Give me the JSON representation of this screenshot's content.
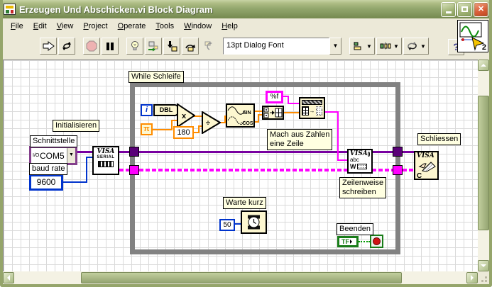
{
  "window": {
    "title": "Erzeugen Und Abschicken.vi Block Diagram"
  },
  "menu": {
    "items": [
      "File",
      "Edit",
      "View",
      "Project",
      "Operate",
      "Tools",
      "Window",
      "Help"
    ]
  },
  "toolbar": {
    "font_selector": "13pt Dialog Font",
    "help_label": "?",
    "vi_badge": "2"
  },
  "diagram": {
    "labels": {
      "initialize": "Initialisieren",
      "interface": "Schnittstelle",
      "baud_rate": "baud rate",
      "while_loop": "While Schleife",
      "make_line_1": "Mach aus Zahlen",
      "make_line_2": "eine Zeile",
      "wait_short": "Warte kurz",
      "write_lines_1": "Zeilenweise",
      "write_lines_2": "schreiben",
      "stop": "Beenden",
      "close": "Schliessen"
    },
    "values": {
      "com_port": "COM5",
      "io_glyph": "I/O",
      "baud": "9600",
      "iteration": "i",
      "dbl": "DBL",
      "pi": "π",
      "c180": "180",
      "multiply": "x",
      "divide": "÷",
      "sin": "SIN",
      "cos": ":COS",
      "format": "%f",
      "wait_ms": "50",
      "tf": "TF",
      "visa": "VISA",
      "serial": "SERIAL",
      "abc": "abc",
      "w": "W",
      "c": "C"
    },
    "colors": {
      "visa_wire": "#7800a0",
      "error_wire": "#ff00ff",
      "string_wire": "#ff00ff",
      "numeric_wire": "#ff8c00",
      "int_wire": "#0033cc",
      "bool_wire": "#009900",
      "loop_border": "#828282"
    }
  }
}
